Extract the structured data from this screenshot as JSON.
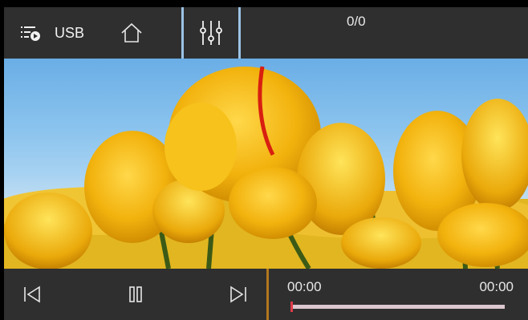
{
  "topbar": {
    "source_label": "USB",
    "track_counter": "0/0",
    "icons": {
      "playlist": "playlist-play-icon",
      "home": "home-icon",
      "equalizer": "equalizer-icon"
    },
    "separator_color": "#9cc3e6"
  },
  "media": {
    "image_subject": "yellow tulips against blue sky"
  },
  "player": {
    "current_time": "00:00",
    "total_time": "00:00",
    "progress": 0,
    "controls": [
      "previous-icon",
      "pause-icon",
      "next-icon"
    ],
    "accent_color": "#b2771d",
    "thumb_color": "#e03a4a"
  }
}
